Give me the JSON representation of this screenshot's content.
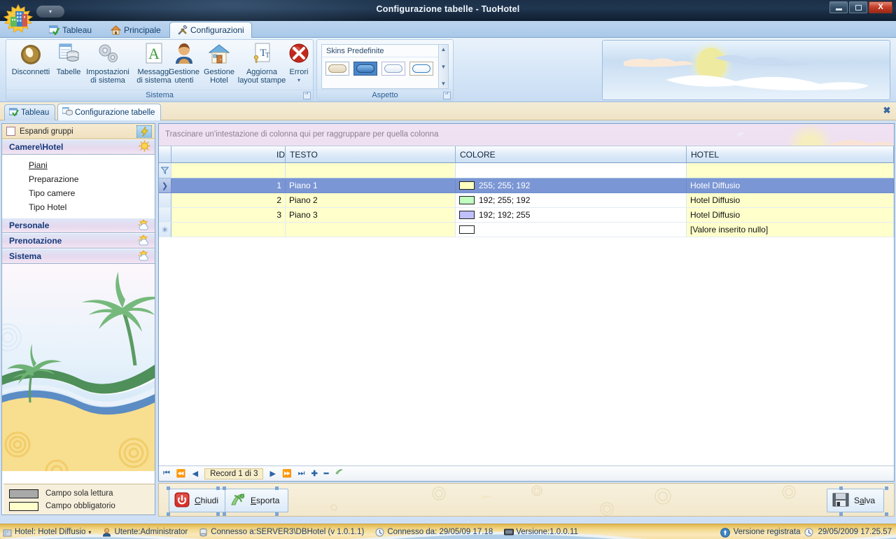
{
  "window": {
    "title": "Configurazione tabelle - TuoHotel",
    "buttons": {
      "minimize": "minimize-icon",
      "restore": "restore-icon",
      "close": "X"
    }
  },
  "quick_access": {
    "dropdown": "▾"
  },
  "ribbon": {
    "tabs": [
      {
        "label": "Tableau",
        "icon": "tableau-icon",
        "active": false
      },
      {
        "label": "Principale",
        "icon": "home-icon",
        "active": false
      },
      {
        "label": "Configurazioni",
        "icon": "tools-icon",
        "active": true
      }
    ],
    "groups": [
      {
        "label": "Sistema",
        "buttons": [
          {
            "line1": "Disconnetti",
            "line2": "",
            "icon": "disconnect-icon"
          },
          {
            "line1": "Tabelle",
            "line2": "",
            "icon": "tables-icon"
          },
          {
            "line1": "Impostazioni",
            "line2": "di sistema",
            "icon": "gears-icon"
          },
          {
            "line1": "Messaggi",
            "line2": "di sistema",
            "icon": "letter-a-icon"
          },
          {
            "line1": "Gestione",
            "line2": "utenti",
            "icon": "user-icon"
          },
          {
            "line1": "Gestione",
            "line2": "Hotel",
            "icon": "house-icon"
          },
          {
            "line1": "Aggiorna",
            "line2": "layout stampe",
            "icon": "print-layout-icon",
            "dropdown": "▾"
          },
          {
            "line1": "Errori",
            "line2": "",
            "icon": "error-x-icon",
            "dropdown": "▾"
          }
        ]
      },
      {
        "label": "Aspetto",
        "gallery_title": "Skins Predefinite",
        "swatches": [
          "#efe8d8",
          "#4f8fd0",
          "#ffffff",
          "#ffffff"
        ],
        "scroll": {
          "up": "▲",
          "down": "▼",
          "more": "▼"
        }
      }
    ]
  },
  "doc_tabs": {
    "items": [
      {
        "label": "Tableau",
        "icon": "tableau-icon",
        "active": false
      },
      {
        "label": "Configurazione tabelle",
        "icon": "tables-icon",
        "active": true
      }
    ],
    "close": "✖"
  },
  "sidebar": {
    "expand_groups_label": "Espandi gruppi",
    "expand_groups_checked": false,
    "flash_icon": "lightning-icon",
    "groups": [
      {
        "label": "Camere\\Hotel",
        "icon": "sun-icon",
        "expanded": true,
        "items": [
          {
            "label": "Piani",
            "selected": true
          },
          {
            "label": "Preparazione",
            "selected": false
          },
          {
            "label": "Tipo camere",
            "selected": false
          },
          {
            "label": "Tipo Hotel",
            "selected": false
          }
        ]
      },
      {
        "label": "Personale",
        "icon": "sun-cloud-icon",
        "expanded": false,
        "items": []
      },
      {
        "label": "Prenotazione",
        "icon": "sun-cloud-icon",
        "expanded": false,
        "items": []
      },
      {
        "label": "Sistema",
        "icon": "sun-cloud-icon",
        "expanded": false,
        "items": []
      }
    ],
    "legend": [
      {
        "color": "#a9a9a9",
        "label": "Campo sola lettura"
      },
      {
        "color": "#ffffcc",
        "label": "Campo obbligatorio"
      }
    ]
  },
  "grid": {
    "group_hint": "Trascinare un'intestazione di colonna qui per raggruppare per quella colonna",
    "columns": [
      "ID",
      "TESTO",
      "COLORE",
      "HOTEL"
    ],
    "filter_row": {
      "id": "",
      "testo": "",
      "colore": "",
      "hotel": ""
    },
    "rows": [
      {
        "id": "1",
        "testo": "Piano 1",
        "colore_text": "255; 255; 192",
        "colore_hex": "#ffffc0",
        "hotel": "Hotel Diffusio",
        "selected": true,
        "marker": "❯"
      },
      {
        "id": "2",
        "testo": "Piano 2",
        "colore_text": "192; 255; 192",
        "colore_hex": "#c0ffc0",
        "hotel": "Hotel Diffusio",
        "selected": false,
        "marker": ""
      },
      {
        "id": "3",
        "testo": "Piano 3",
        "colore_text": "192; 192; 255",
        "colore_hex": "#c0c0ff",
        "hotel": "Hotel Diffusio",
        "selected": false,
        "marker": ""
      },
      {
        "id": "",
        "testo": "",
        "colore_text": "",
        "colore_hex": "#ffffff",
        "hotel": "[Valore inserito nullo]",
        "selected": false,
        "marker": "✳"
      }
    ],
    "navigator": {
      "first": "⏮",
      "prev_page": "⏪",
      "prev": "◀",
      "record_label": "Record 1 di 3",
      "next": "▶",
      "next_page": "⏩",
      "last": "⏭",
      "add": "✚",
      "remove": "━",
      "edit": "edit-icon"
    }
  },
  "actions": {
    "close_button": {
      "label": "Chiudi",
      "mnemonic": "C",
      "icon": "power-icon"
    },
    "export_button": {
      "label": "Esporta",
      "mnemonic": "E",
      "icon": "export-icon"
    },
    "save_button": {
      "label": "Salva",
      "mnemonic": "a",
      "icon": "floppy-icon"
    }
  },
  "statusbar": {
    "items": [
      {
        "icon": "hotel-icon",
        "text": "Hotel: Hotel Diffusio",
        "caret": "▾"
      },
      {
        "icon": "user-icon",
        "text": "Utente:Administrator"
      },
      {
        "icon": "database-icon",
        "text": "Connesso a:SERVER3\\DBHotel (v 1.0.1.1)"
      },
      {
        "icon": "clock-icon",
        "text": "Connesso da: 29/05/09 17.18"
      },
      {
        "icon": "monitor-icon",
        "text": "Versione:1.0.0.11"
      }
    ],
    "right": [
      {
        "icon": "registered-icon",
        "text": "Versione registrata"
      },
      {
        "icon": "clock-icon",
        "text": "29/05/2009 17.25.57"
      }
    ]
  }
}
